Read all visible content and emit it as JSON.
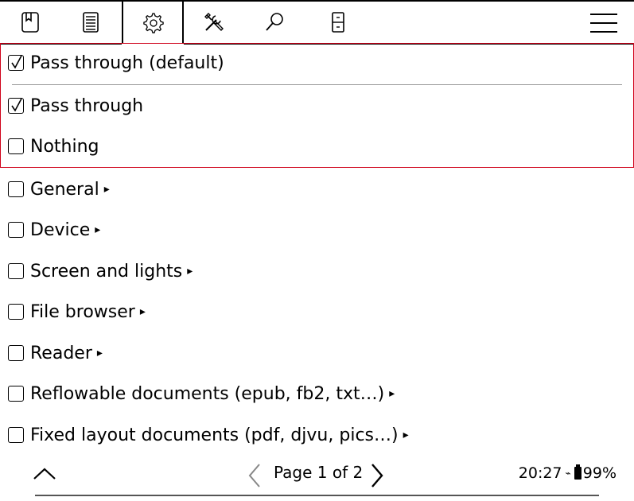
{
  "toolbar": {
    "tabs": [
      {
        "name": "bookmark-icon"
      },
      {
        "name": "document-icon"
      },
      {
        "name": "gear-icon"
      },
      {
        "name": "tools-icon"
      },
      {
        "name": "search-icon"
      },
      {
        "name": "cabinet-icon"
      }
    ],
    "menu_icon": "hamburger-menu-icon"
  },
  "popup": {
    "items": [
      {
        "label": "Pass through (default)",
        "checked": true
      },
      {
        "label": "Pass through",
        "checked": true
      },
      {
        "label": "Nothing",
        "checked": false
      }
    ]
  },
  "menu": {
    "items": [
      {
        "label": "General",
        "arrow": "▸"
      },
      {
        "label": "Device",
        "arrow": "▸"
      },
      {
        "label": "Screen and lights",
        "arrow": "▸"
      },
      {
        "label": "File browser",
        "arrow": "▸"
      },
      {
        "label": "Reader",
        "arrow": "▸"
      },
      {
        "label": "Reflowable documents (epub, fb2, txt…)",
        "arrow": "▸"
      },
      {
        "label": "Fixed layout documents (pdf, djvu, pics…)",
        "arrow": "▸"
      }
    ]
  },
  "footer": {
    "page_text": "Page 1 of 2",
    "time": "20:27",
    "battery": "99%",
    "wifi_glyph": "⌁"
  }
}
